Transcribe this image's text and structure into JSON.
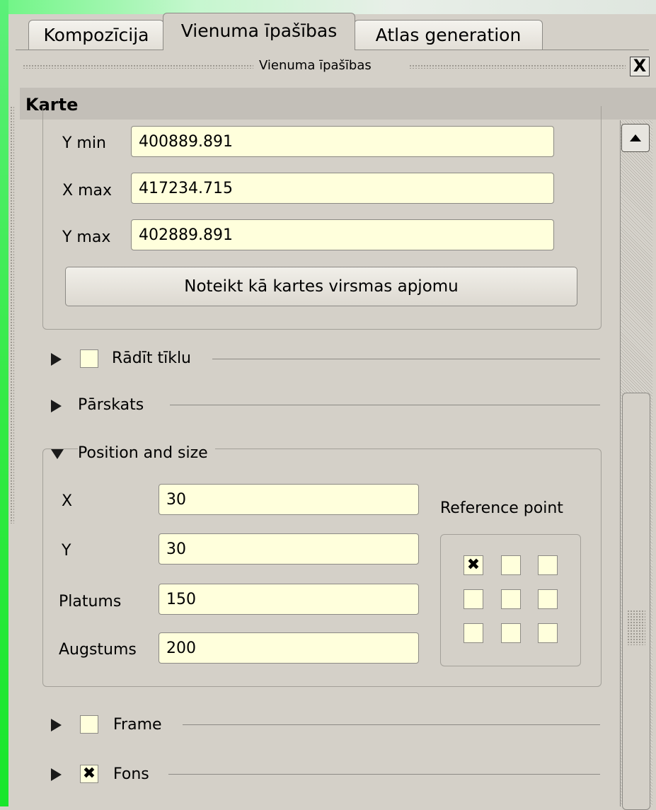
{
  "tabs": [
    {
      "label": "Kompozīcija"
    },
    {
      "label": "Vienuma īpašības"
    },
    {
      "label": "Atlas generation"
    }
  ],
  "panel": {
    "title": "Vienuma īpašības",
    "close_label": "X"
  },
  "section": {
    "title": "Karte"
  },
  "extent": {
    "ymin_label": "Y min",
    "ymin_value": "400889.891",
    "xmax_label": "X max",
    "xmax_value": "417234.715",
    "ymax_label": "Y max",
    "ymax_value": "402889.891",
    "set_extent_button": "Noteikt kā kartes virsmas apjomu"
  },
  "grid": {
    "label": "Rādīt tīklu",
    "checked": false
  },
  "overview": {
    "label": "Pārskats"
  },
  "position": {
    "title": "Position and size",
    "x_label": "X",
    "x_value": "30",
    "y_label": "Y",
    "y_value": "30",
    "width_label": "Platums",
    "width_value": "150",
    "height_label": "Augstums",
    "height_value": "200",
    "reference_label": "Reference point",
    "reference_mark": "✖",
    "reference_selected": "top-left"
  },
  "frame": {
    "label": "Frame",
    "checked": false
  },
  "background": {
    "label": "Fons",
    "checked": true,
    "mark": "✖"
  },
  "colors": {
    "field_bg": "#ffffdc",
    "window_bg": "#d4d0c8",
    "header_bg": "#c3bfb8"
  }
}
